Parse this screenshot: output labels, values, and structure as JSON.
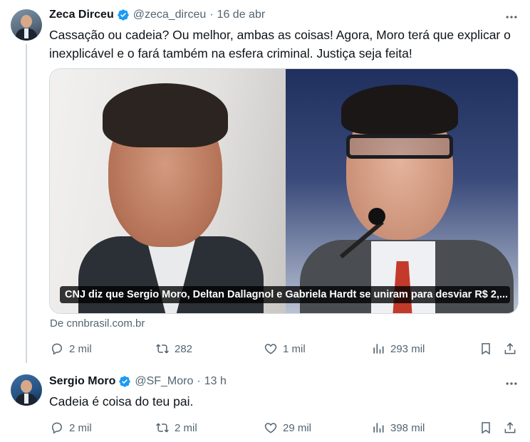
{
  "tweets": [
    {
      "author_name": "Zeca Dirceu",
      "handle": "@zeca_dirceu",
      "separator": "·",
      "time": "16 de abr",
      "text": "Cassação ou cadeia? Ou melhor, ambas as coisas! Agora, Moro terá que explicar o inexplicável e o fará também na esfera criminal. Justiça seja feita!",
      "card": {
        "caption": "CNJ diz que Sergio Moro, Deltan Dallagnol e Gabriela Hardt se uniram para desviar R$ 2,...",
        "source": "De cnnbrasil.com.br"
      },
      "stats": {
        "replies": "2 mil",
        "reposts": "282",
        "likes": "1 mil",
        "views": "293 mil"
      }
    },
    {
      "author_name": "Sergio Moro",
      "handle": "@SF_Moro",
      "separator": "·",
      "time": "13 h",
      "text": "Cadeia é coisa do teu pai.",
      "stats": {
        "replies": "2 mil",
        "reposts": "2 mil",
        "likes": "29 mil",
        "views": "398 mil"
      }
    }
  ],
  "colors": {
    "verified": "#1d9bf0",
    "secondary_text": "#536471",
    "thread_line": "#cfd9de"
  },
  "icons": [
    "verified-badge-icon",
    "more-icon",
    "reply-icon",
    "repost-icon",
    "like-icon",
    "views-icon",
    "bookmark-icon",
    "share-icon"
  ]
}
